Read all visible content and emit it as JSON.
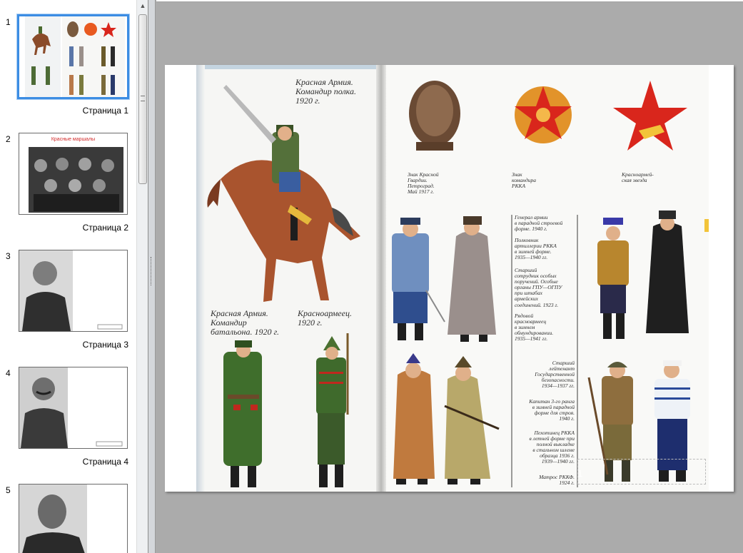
{
  "slides": [
    {
      "number": "1",
      "label": "Страница 1",
      "selected": true
    },
    {
      "number": "2",
      "label": "Страница 2",
      "title": "Красные маршалы"
    },
    {
      "number": "3",
      "label": "Страница 3"
    },
    {
      "number": "4",
      "label": "Страница 4"
    },
    {
      "number": "5",
      "label": ""
    }
  ],
  "slide_captions": {
    "commander_regiment": "Красная Армия.\nКомандир полка.\n1920 г.",
    "commander_battalion": "Красная Армия.\nКомандир\nбатальона. 1920 г.",
    "red_army_soldier": "Красноармеец.\n1920 г.",
    "badge_red_guard": "Знак Красной\nГвардии.\nПетроград.\nМай 1917 г.",
    "badge_commander": "Знак\nкомандира\nРККА",
    "red_star": "Красноармей-\nская звезда",
    "general_army": "Генерал армии\nв парадной строевой\nформе. 1940 г.",
    "colonel_artillery": "Полковник\nартиллерии РККА\nв зимней форме.\n1935—1940 гг.",
    "senior_officer": "Старший\nсотрудник особых\nпоручений. Особые\nорганы ГПУ—ОГПУ\nпри штабах\nармейских\nсоединений. 1923 г.",
    "private_winter": "Рядовой\nкрасноармеец\nв зимнем\nобмундировании.\n1935—1941 гг.",
    "senior_lieutenant": "Старший\nлейтенант\nГосударственной\nбезопасности.\n1934—1937 гг.",
    "captain_3rd_rank": "Капитан 3-го ранга\nв зимней парадной\nформе для строя.\n1940 г.",
    "infantryman": "Пехотинец РККА\nв летней форме при\nполной выкладке\nв стальном шлеме\nобразца 1936 г.\n1939—1940 гг.",
    "sailor": "Матрос РККФ.\n1924 г."
  },
  "page_number": "1",
  "colors": {
    "selection": "#3c8de3",
    "workspace": "#ababab",
    "badge_red": "#d9261c",
    "uniform_green": "#4d6b36"
  }
}
